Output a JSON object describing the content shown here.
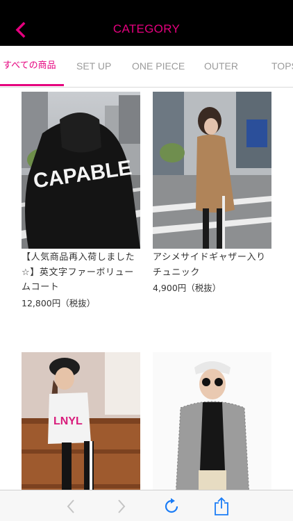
{
  "header": {
    "title": "CATEGORY",
    "back_icon": "chevron-left-icon"
  },
  "tabs": [
    {
      "label": "すべての商品",
      "active": true
    },
    {
      "label": "SET UP",
      "active": false
    },
    {
      "label": "ONE PIECE",
      "active": false
    },
    {
      "label": "OUTER",
      "active": false
    },
    {
      "label": "TOPS",
      "active": false
    }
  ],
  "products": [
    {
      "name": "【人気商品再入荷しました☆】英文字ファーボリュームコート",
      "price": "12,800円（税抜）"
    },
    {
      "name": "アシメサイドギャザー入りチュニック",
      "price": "4,900円（税抜）"
    },
    {
      "name": "",
      "price": ""
    },
    {
      "name": "",
      "price": ""
    }
  ],
  "toolbar": {
    "back_icon": "arrow-left-icon",
    "forward_icon": "arrow-right-icon",
    "reload_icon": "reload-icon",
    "share_icon": "share-icon"
  },
  "colors": {
    "accent": "#e5007e",
    "header_bg": "#000000",
    "toolbar_bg": "#f7f7f7",
    "ios_blue": "#1a7cf6"
  }
}
